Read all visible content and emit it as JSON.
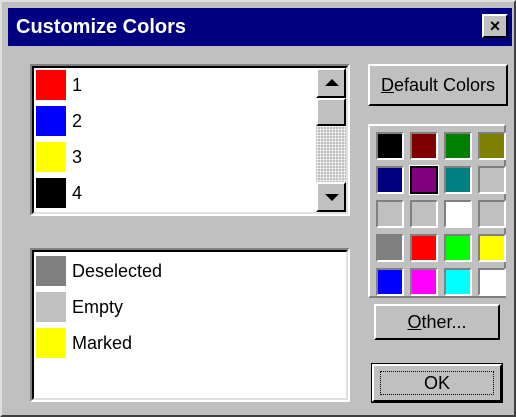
{
  "window": {
    "title": "Customize Colors",
    "close_symbol": "×",
    "close_icon": "close-icon"
  },
  "color_list": {
    "items": [
      {
        "label": "1",
        "color": "#ff0000"
      },
      {
        "label": "2",
        "color": "#0000ff"
      },
      {
        "label": "3",
        "color": "#ffff00"
      },
      {
        "label": "4",
        "color": "#000000"
      }
    ],
    "scrollbar": {
      "up_icon": "arrow-up-icon",
      "down_icon": "arrow-down-icon"
    }
  },
  "state_list": {
    "items": [
      {
        "label": "Deselected",
        "color": "#808080"
      },
      {
        "label": "Empty",
        "color": "#c0c0c0"
      },
      {
        "label": "Marked",
        "color": "#ffff00"
      }
    ]
  },
  "buttons": {
    "default_colors": {
      "label": "Default Colors",
      "accel": "D"
    },
    "other": {
      "label": "Other...",
      "accel": "O"
    },
    "ok": {
      "label": "OK"
    }
  },
  "palette": {
    "colors": [
      "#000000",
      "#800000",
      "#008000",
      "#808000",
      "#000080",
      "#800080",
      "#008080",
      "#c0c0c0",
      "#c0c0c0",
      "#c0c0c0",
      "#ffffff",
      "#c0c0c0",
      "#808080",
      "#ff0000",
      "#00ff00",
      "#ffff00",
      "#0000ff",
      "#ff00ff",
      "#00ffff",
      "#ffffff"
    ],
    "selected": "#800080"
  }
}
